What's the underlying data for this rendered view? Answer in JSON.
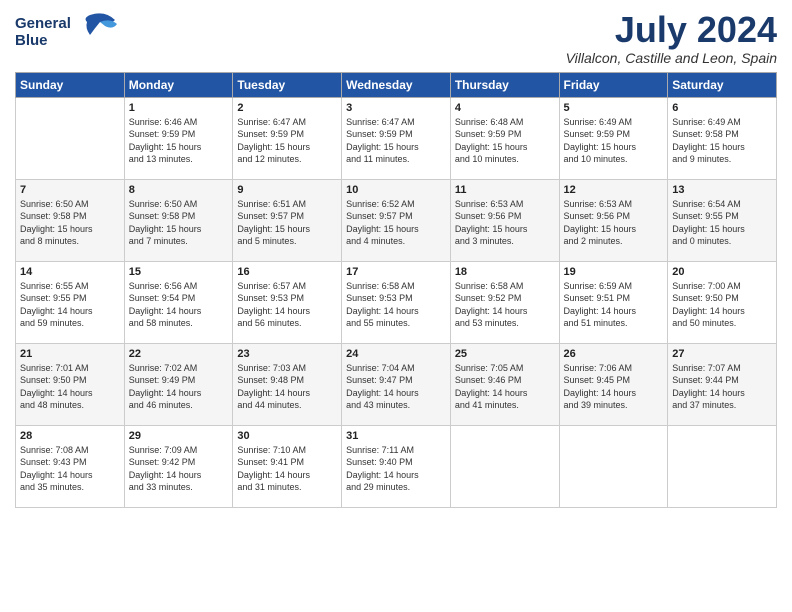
{
  "header": {
    "logo_line1": "General",
    "logo_line2": "Blue",
    "title": "July 2024",
    "subtitle": "Villalcon, Castille and Leon, Spain"
  },
  "weekdays": [
    "Sunday",
    "Monday",
    "Tuesday",
    "Wednesday",
    "Thursday",
    "Friday",
    "Saturday"
  ],
  "weeks": [
    [
      {
        "day": "",
        "info": ""
      },
      {
        "day": "1",
        "info": "Sunrise: 6:46 AM\nSunset: 9:59 PM\nDaylight: 15 hours\nand 13 minutes."
      },
      {
        "day": "2",
        "info": "Sunrise: 6:47 AM\nSunset: 9:59 PM\nDaylight: 15 hours\nand 12 minutes."
      },
      {
        "day": "3",
        "info": "Sunrise: 6:47 AM\nSunset: 9:59 PM\nDaylight: 15 hours\nand 11 minutes."
      },
      {
        "day": "4",
        "info": "Sunrise: 6:48 AM\nSunset: 9:59 PM\nDaylight: 15 hours\nand 10 minutes."
      },
      {
        "day": "5",
        "info": "Sunrise: 6:49 AM\nSunset: 9:59 PM\nDaylight: 15 hours\nand 10 minutes."
      },
      {
        "day": "6",
        "info": "Sunrise: 6:49 AM\nSunset: 9:58 PM\nDaylight: 15 hours\nand 9 minutes."
      }
    ],
    [
      {
        "day": "7",
        "info": "Sunrise: 6:50 AM\nSunset: 9:58 PM\nDaylight: 15 hours\nand 8 minutes."
      },
      {
        "day": "8",
        "info": "Sunrise: 6:50 AM\nSunset: 9:58 PM\nDaylight: 15 hours\nand 7 minutes."
      },
      {
        "day": "9",
        "info": "Sunrise: 6:51 AM\nSunset: 9:57 PM\nDaylight: 15 hours\nand 5 minutes."
      },
      {
        "day": "10",
        "info": "Sunrise: 6:52 AM\nSunset: 9:57 PM\nDaylight: 15 hours\nand 4 minutes."
      },
      {
        "day": "11",
        "info": "Sunrise: 6:53 AM\nSunset: 9:56 PM\nDaylight: 15 hours\nand 3 minutes."
      },
      {
        "day": "12",
        "info": "Sunrise: 6:53 AM\nSunset: 9:56 PM\nDaylight: 15 hours\nand 2 minutes."
      },
      {
        "day": "13",
        "info": "Sunrise: 6:54 AM\nSunset: 9:55 PM\nDaylight: 15 hours\nand 0 minutes."
      }
    ],
    [
      {
        "day": "14",
        "info": "Sunrise: 6:55 AM\nSunset: 9:55 PM\nDaylight: 14 hours\nand 59 minutes."
      },
      {
        "day": "15",
        "info": "Sunrise: 6:56 AM\nSunset: 9:54 PM\nDaylight: 14 hours\nand 58 minutes."
      },
      {
        "day": "16",
        "info": "Sunrise: 6:57 AM\nSunset: 9:53 PM\nDaylight: 14 hours\nand 56 minutes."
      },
      {
        "day": "17",
        "info": "Sunrise: 6:58 AM\nSunset: 9:53 PM\nDaylight: 14 hours\nand 55 minutes."
      },
      {
        "day": "18",
        "info": "Sunrise: 6:58 AM\nSunset: 9:52 PM\nDaylight: 14 hours\nand 53 minutes."
      },
      {
        "day": "19",
        "info": "Sunrise: 6:59 AM\nSunset: 9:51 PM\nDaylight: 14 hours\nand 51 minutes."
      },
      {
        "day": "20",
        "info": "Sunrise: 7:00 AM\nSunset: 9:50 PM\nDaylight: 14 hours\nand 50 minutes."
      }
    ],
    [
      {
        "day": "21",
        "info": "Sunrise: 7:01 AM\nSunset: 9:50 PM\nDaylight: 14 hours\nand 48 minutes."
      },
      {
        "day": "22",
        "info": "Sunrise: 7:02 AM\nSunset: 9:49 PM\nDaylight: 14 hours\nand 46 minutes."
      },
      {
        "day": "23",
        "info": "Sunrise: 7:03 AM\nSunset: 9:48 PM\nDaylight: 14 hours\nand 44 minutes."
      },
      {
        "day": "24",
        "info": "Sunrise: 7:04 AM\nSunset: 9:47 PM\nDaylight: 14 hours\nand 43 minutes."
      },
      {
        "day": "25",
        "info": "Sunrise: 7:05 AM\nSunset: 9:46 PM\nDaylight: 14 hours\nand 41 minutes."
      },
      {
        "day": "26",
        "info": "Sunrise: 7:06 AM\nSunset: 9:45 PM\nDaylight: 14 hours\nand 39 minutes."
      },
      {
        "day": "27",
        "info": "Sunrise: 7:07 AM\nSunset: 9:44 PM\nDaylight: 14 hours\nand 37 minutes."
      }
    ],
    [
      {
        "day": "28",
        "info": "Sunrise: 7:08 AM\nSunset: 9:43 PM\nDaylight: 14 hours\nand 35 minutes."
      },
      {
        "day": "29",
        "info": "Sunrise: 7:09 AM\nSunset: 9:42 PM\nDaylight: 14 hours\nand 33 minutes."
      },
      {
        "day": "30",
        "info": "Sunrise: 7:10 AM\nSunset: 9:41 PM\nDaylight: 14 hours\nand 31 minutes."
      },
      {
        "day": "31",
        "info": "Sunrise: 7:11 AM\nSunset: 9:40 PM\nDaylight: 14 hours\nand 29 minutes."
      },
      {
        "day": "",
        "info": ""
      },
      {
        "day": "",
        "info": ""
      },
      {
        "day": "",
        "info": ""
      }
    ]
  ]
}
